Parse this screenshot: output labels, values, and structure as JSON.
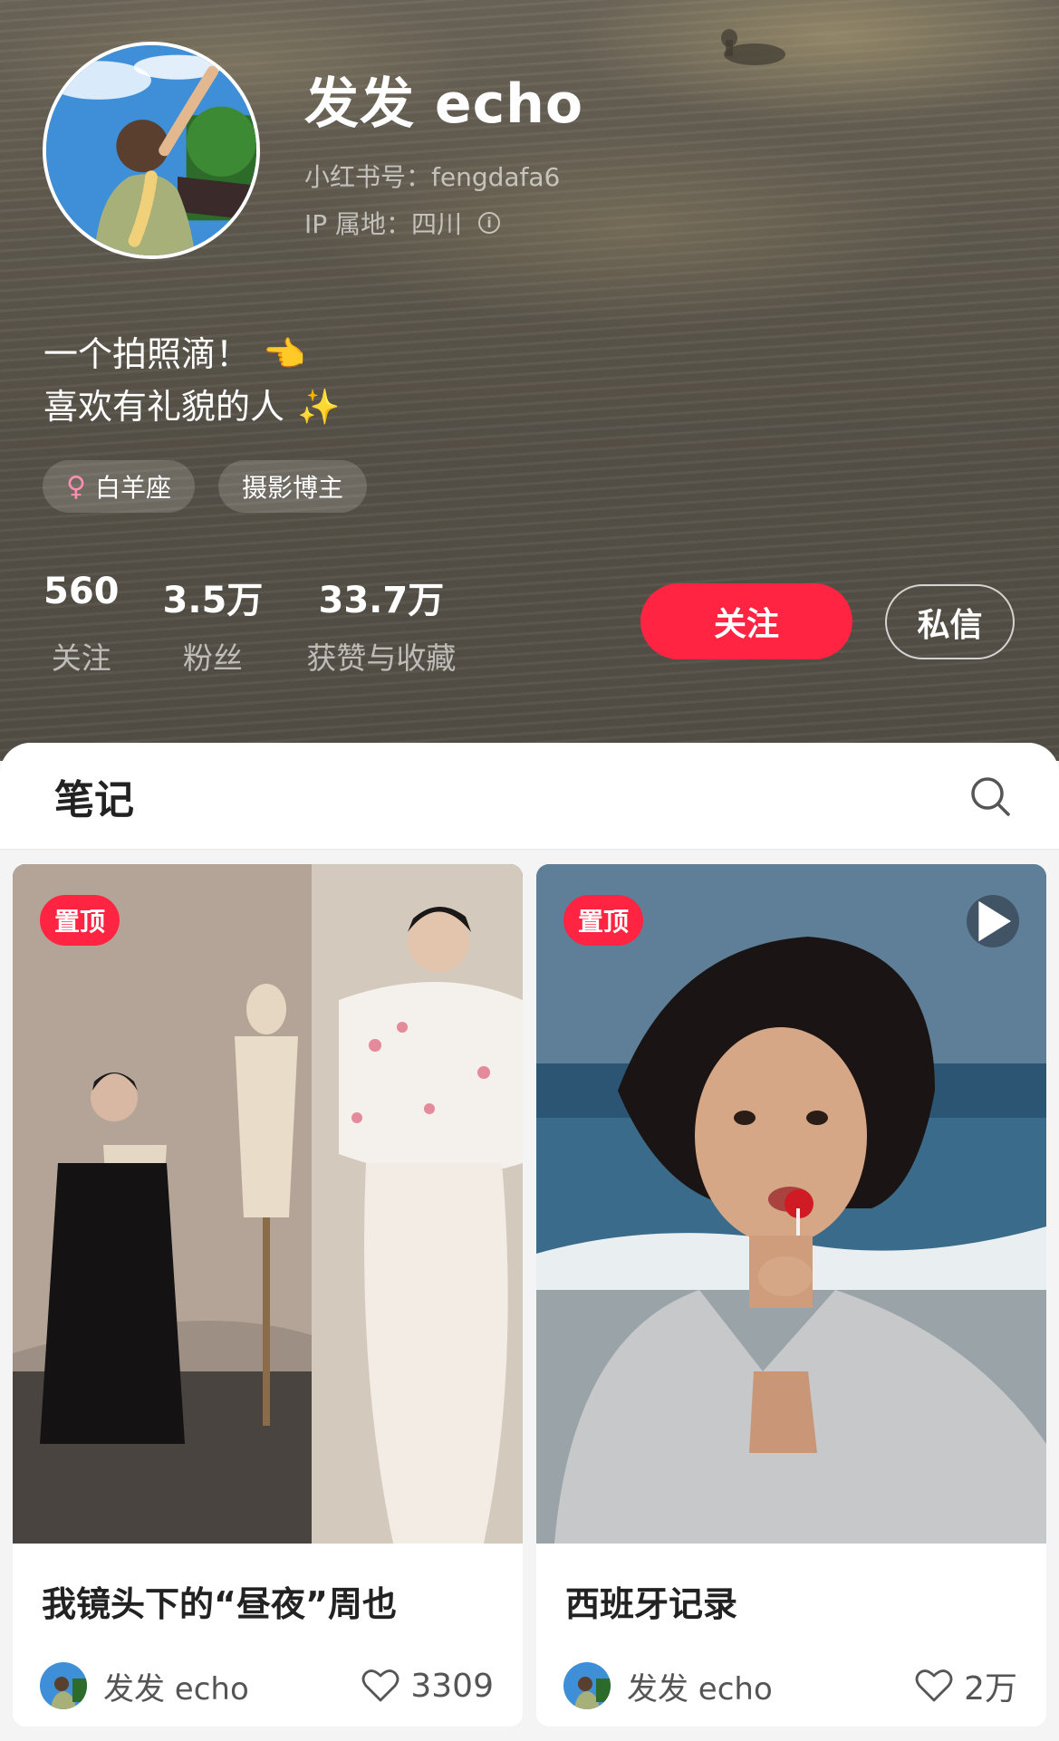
{
  "profile": {
    "name": "发发 echo",
    "xhs_id": "小红书号：fengdafa6",
    "ip": "IP 属地：四川",
    "bio_line1": "一个拍照滴！",
    "bio_line1_emoji": "👈",
    "bio_line2": "喜欢有礼貌的人",
    "bio_line2_emoji": "✨",
    "tags": [
      {
        "icon": "female-icon",
        "label": "白羊座"
      },
      {
        "label": "摄影博主"
      }
    ],
    "stats": [
      {
        "num": "560",
        "label": "关注"
      },
      {
        "num": "3.5万",
        "label": "粉丝"
      },
      {
        "num": "33.7万",
        "label": "获赞与收藏"
      }
    ],
    "follow_label": "关注",
    "message_label": "私信"
  },
  "notes": {
    "title": "笔记",
    "pin_label": "置顶",
    "cards": [
      {
        "title": "我镜头下的“昼夜”周也",
        "author": "发发 echo",
        "likes": "3309",
        "video": false
      },
      {
        "title": "西班牙记录",
        "author": "发发 echo",
        "likes": "2万",
        "video": true
      }
    ]
  },
  "colors": {
    "accent": "#ff2442",
    "header_bg": "#5f594e"
  }
}
